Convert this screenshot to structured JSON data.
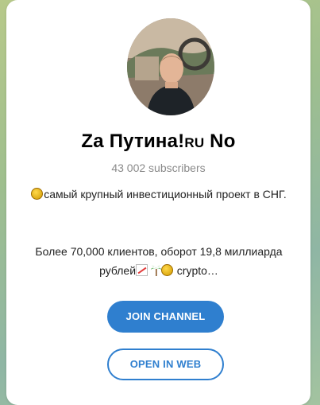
{
  "channel": {
    "title_main": "Za Путина!",
    "title_small": "RU",
    "title_end": " No",
    "subscribers": "43 002 subscribers",
    "description_line1": "самый крупный инвестиционный проект в СНГ.",
    "description_line2a": "Более 70,000 клиентов, оборот 19,8 миллиарда рублей",
    "description_line2b": " crypto…"
  },
  "buttons": {
    "join": "JOIN CHANNEL",
    "web": "OPEN IN WEB"
  },
  "colors": {
    "accent": "#2f7fcf",
    "background": "#a3c3a0"
  }
}
